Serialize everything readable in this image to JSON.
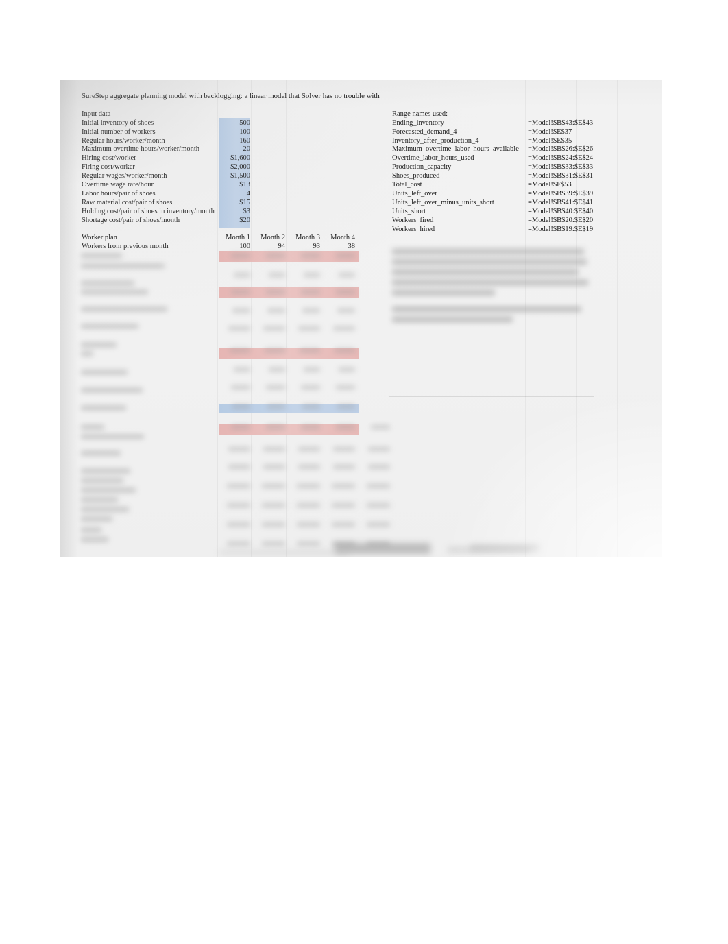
{
  "document": {
    "title": "SureStep aggregate planning model with backlogging: a linear model that Solver has no trouble with"
  },
  "input_data": {
    "heading": "Input data",
    "rows": [
      {
        "label": "Initial inventory of shoes",
        "value": "500"
      },
      {
        "label": "Initial number of workers",
        "value": "100"
      },
      {
        "label": "Regular hours/worker/month",
        "value": "160"
      },
      {
        "label": "Maximum overtime hours/worker/month",
        "value": "20"
      },
      {
        "label": "Hiring cost/worker",
        "value": "$1,600"
      },
      {
        "label": "Firing cost/worker",
        "value": "$2,000"
      },
      {
        "label": "Regular wages/worker/month",
        "value": "$1,500"
      },
      {
        "label": "Overtime wage rate/hour",
        "value": "$13"
      },
      {
        "label": "Labor hours/pair of shoes",
        "value": "4"
      },
      {
        "label": "Raw material cost/pair of shoes",
        "value": "$15"
      },
      {
        "label": "Holding cost/pair of shoes in inventory/month",
        "value": "$3"
      },
      {
        "label": "Shortage cost/pair of shoes/month",
        "value": "$20"
      }
    ]
  },
  "worker_plan": {
    "heading": "Worker plan",
    "months": [
      "Month 1",
      "Month 2",
      "Month 3",
      "Month 4"
    ],
    "rows": [
      {
        "label": "Workers from previous month",
        "values": [
          "100",
          "94",
          "93",
          "38"
        ]
      }
    ]
  },
  "range_names": {
    "heading": "Range names used:",
    "rows": [
      {
        "name": "Ending_inventory",
        "ref": "=Model!$B$43:$E$43"
      },
      {
        "name": "Forecasted_demand_4",
        "ref": "=Model!$E$37"
      },
      {
        "name": "Inventory_after_production_4",
        "ref": "=Model!$E$35"
      },
      {
        "name": "Maximum_overtime_labor_hours_available",
        "ref": "=Model!$B$26:$E$26"
      },
      {
        "name": "Overtime_labor_hours_used",
        "ref": "=Model!$B$24:$E$24"
      },
      {
        "name": "Production_capacity",
        "ref": "=Model!$B$33:$E$33"
      },
      {
        "name": "Shoes_produced",
        "ref": "=Model!$B$31:$E$31"
      },
      {
        "name": "Total_cost",
        "ref": "=Model!$F$53"
      },
      {
        "name": "Units_left_over",
        "ref": "=Model!$B$39:$E$39"
      },
      {
        "name": "Units_left_over_minus_units_short",
        "ref": "=Model!$B$41:$E$41"
      },
      {
        "name": "Units_short",
        "ref": "=Model!$B$40:$E$40"
      },
      {
        "name": "Workers_fired",
        "ref": "=Model!$B$20:$E$20"
      },
      {
        "name": "Workers_hired",
        "ref": "=Model!$B$19:$E$19"
      }
    ]
  },
  "colors": {
    "input_highlight": "#b9cde5",
    "changing_cells_highlight": "#b9cde5",
    "constraint_highlight": "#e8b7b5",
    "page_background": "#f1f1f1",
    "text": "#1d1d1d"
  }
}
